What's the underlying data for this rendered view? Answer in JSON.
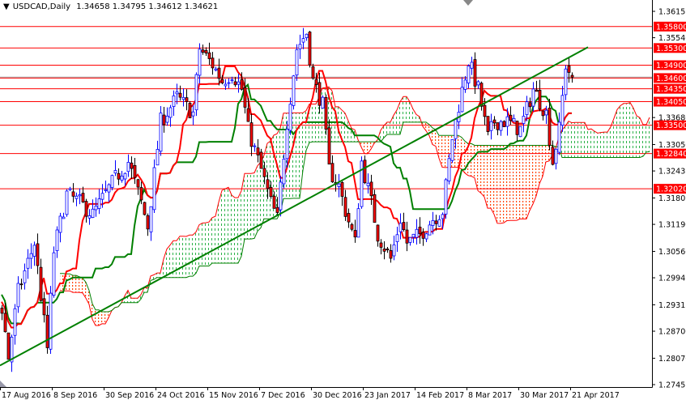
{
  "header": {
    "symbol": "USDCAD,Daily",
    "ohlc": "1.34658 1.34795 1.34612 1.34621"
  },
  "colors": {
    "bull": "#0000ff",
    "bear_body": "#ff0000",
    "bear_wick": "#000000",
    "tenkan": "#ff0000",
    "kijun": "#008000",
    "span_a": "#ff0000",
    "span_b": "#008000",
    "cloud_up": "#2db34a",
    "cloud_down": "#ff4400",
    "level": "#ff0000",
    "trendline": "#008000"
  },
  "chart_data": {
    "type": "candlestick",
    "title": "USDCAD,Daily",
    "indicator": "Ichimoku Kinko Hyo (9,26,52)",
    "ylim": [
      1.27455,
      1.36155
    ],
    "y_ticks": [
      "1.36155",
      "1.35540",
      "1.33680",
      "1.33050",
      "1.32435",
      "1.31805",
      "1.31190",
      "1.30560",
      "1.29945",
      "1.29315",
      "1.28700",
      "1.28070",
      "1.27455"
    ],
    "x_ticks": [
      {
        "label": "17 Aug 2016",
        "bar": 0
      },
      {
        "label": "8 Sep 2016",
        "bar": 16
      },
      {
        "label": "30 Sep 2016",
        "bar": 32
      },
      {
        "label": "24 Oct 2016",
        "bar": 48
      },
      {
        "label": "15 Nov 2016",
        "bar": 64
      },
      {
        "label": "7 Dec 2016",
        "bar": 80
      },
      {
        "label": "30 Dec 2016",
        "bar": 96
      },
      {
        "label": "23 Jan 2017",
        "bar": 112
      },
      {
        "label": "14 Feb 2017",
        "bar": 128
      },
      {
        "label": "8 Mar 2017",
        "bar": 144
      },
      {
        "label": "30 Mar 2017",
        "bar": 160
      },
      {
        "label": "21 Apr 2017",
        "bar": 176
      }
    ],
    "levels": [
      "1.35800",
      "1.35300",
      "1.34900",
      "1.34600",
      "1.34350",
      "1.34050",
      "1.33500",
      "1.32840",
      "1.32020"
    ],
    "current_price": 1.34621,
    "trendline": {
      "from": [
        0,
        1.279
      ],
      "to": [
        181,
        1.3532
      ]
    },
    "close_path": [
      [
        -60,
        1.306
      ],
      [
        -45,
        1.302
      ],
      [
        -30,
        1.2985
      ],
      [
        -15,
        1.296
      ],
      [
        -5,
        1.295
      ],
      [
        0,
        1.2925
      ],
      [
        2,
        1.2808
      ],
      [
        5,
        1.2963
      ],
      [
        10,
        1.3076
      ],
      [
        14,
        1.283
      ],
      [
        16,
        1.3057
      ],
      [
        20,
        1.3189
      ],
      [
        24,
        1.317
      ],
      [
        28,
        1.3142
      ],
      [
        35,
        1.3227
      ],
      [
        39,
        1.3265
      ],
      [
        43,
        1.317
      ],
      [
        45,
        1.3114
      ],
      [
        49,
        1.3359
      ],
      [
        54,
        1.3415
      ],
      [
        59,
        1.3378
      ],
      [
        61,
        1.3529
      ],
      [
        65,
        1.3491
      ],
      [
        68,
        1.3453
      ],
      [
        71,
        1.3472
      ],
      [
        74,
        1.3434
      ],
      [
        76,
        1.334
      ],
      [
        80,
        1.3246
      ],
      [
        83,
        1.317
      ],
      [
        85,
        1.3132
      ],
      [
        88,
        1.3359
      ],
      [
        91,
        1.3529
      ],
      [
        94,
        1.3566
      ],
      [
        96,
        1.3453
      ],
      [
        99,
        1.3397
      ],
      [
        101,
        1.3246
      ],
      [
        104,
        1.3208
      ],
      [
        106,
        1.3151
      ],
      [
        109,
        1.3076
      ],
      [
        111,
        1.3265
      ],
      [
        114,
        1.317
      ],
      [
        116,
        1.3095
      ],
      [
        120,
        1.3038
      ],
      [
        123,
        1.3132
      ],
      [
        125,
        1.3076
      ],
      [
        129,
        1.3095
      ],
      [
        133,
        1.3132
      ],
      [
        136,
        1.3151
      ],
      [
        139,
        1.3321
      ],
      [
        141,
        1.3397
      ],
      [
        144,
        1.35
      ],
      [
        147,
        1.3434
      ],
      [
        150,
        1.3321
      ],
      [
        152,
        1.3359
      ],
      [
        156,
        1.3359
      ],
      [
        160,
        1.334
      ],
      [
        164,
        1.3434
      ],
      [
        168,
        1.3378
      ],
      [
        170,
        1.3265
      ],
      [
        172,
        1.334
      ],
      [
        174,
        1.3491
      ],
      [
        176,
        1.3462
      ]
    ]
  }
}
